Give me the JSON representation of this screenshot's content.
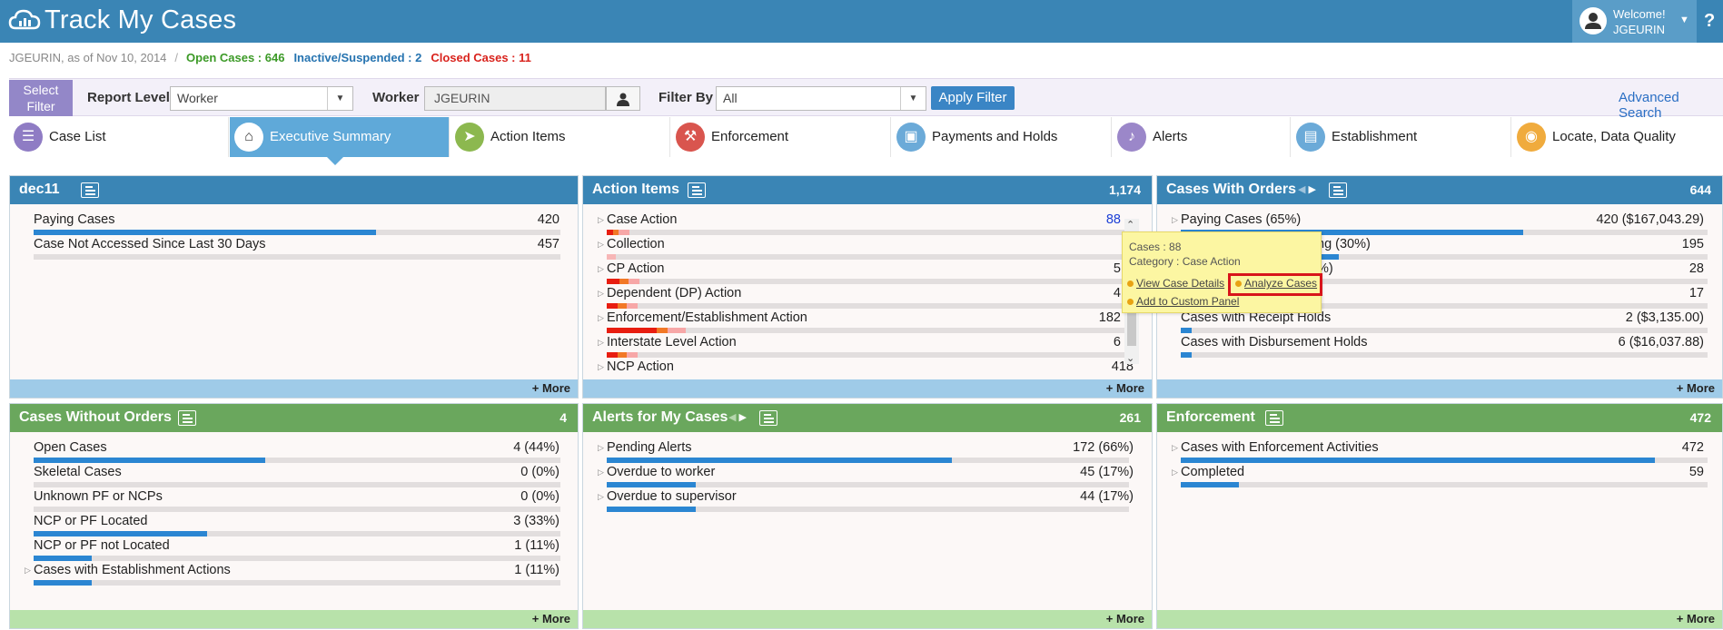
{
  "app": {
    "title": "Track My Cases"
  },
  "user": {
    "welcome": "Welcome!",
    "name": "JGEURIN"
  },
  "status": {
    "user_line": "JGEURIN, as of Nov 10, 2014",
    "separator": "/",
    "open_cases": "Open Cases : 646",
    "inactive": "Inactive/Suspended : 2",
    "closed": "Closed Cases : 11"
  },
  "filter": {
    "select_filter": "Select Filter",
    "report_level_label": "Report Level",
    "report_level_value": "Worker",
    "worker_label": "Worker",
    "worker_value": "JGEURIN",
    "filter_by_label": "Filter By",
    "filter_by_value": "All",
    "apply": "Apply Filter",
    "advanced": "Advanced Search"
  },
  "tabs": [
    {
      "label": "Case List",
      "icon": "list-icon",
      "color": "#8f7cc4"
    },
    {
      "label": "Executive Summary",
      "icon": "home-icon",
      "color": "#ffffff",
      "active": true
    },
    {
      "label": "Action Items",
      "icon": "send-icon",
      "color": "#8cb84f"
    },
    {
      "label": "Enforcement",
      "icon": "gavel-icon",
      "color": "#d9554e"
    },
    {
      "label": "Payments and Holds",
      "icon": "money-icon",
      "color": "#6baad8"
    },
    {
      "label": "Alerts",
      "icon": "bell-icon",
      "color": "#9b87c9"
    },
    {
      "label": "Establishment",
      "icon": "briefcase-icon",
      "color": "#6baad8"
    },
    {
      "label": "Locate, Data Quality",
      "icon": "map-pin-icon",
      "color": "#f0ab3d"
    }
  ],
  "panels": {
    "dec11": {
      "title": "dec11",
      "count": "",
      "more": "+ More",
      "rows": [
        {
          "label": "Paying Cases",
          "value": "420",
          "pct": 0.65
        },
        {
          "label": "Case Not Accessed Since Last 30 Days",
          "value": "457",
          "pct": 0
        }
      ]
    },
    "action_items": {
      "title": "Action Items",
      "count": "1,174",
      "more": "+ More",
      "rows": [
        {
          "label": "Case Action",
          "value": "88"
        },
        {
          "label": "Collection",
          "value": ""
        },
        {
          "label": "CP Action",
          "value": "5"
        },
        {
          "label": "Dependent (DP) Action",
          "value": "4"
        },
        {
          "label": "Enforcement/Establishment Action",
          "value": "182"
        },
        {
          "label": "Interstate Level Action",
          "value": "6"
        },
        {
          "label": "NCP Action",
          "value": "418"
        }
      ]
    },
    "cases_with_orders": {
      "title": "Cases With Orders",
      "count": "644",
      "more": "+ More",
      "rows": [
        {
          "label": "Paying Cases (65%)",
          "value": "420 ($167,043.29)",
          "pct": 0.65
        },
        {
          "label": "ng (30%)",
          "value": "195",
          "pct": 0.3
        },
        {
          "label": "%)",
          "value": "28",
          "pct": 0.04
        },
        {
          "label": ")",
          "value": "17",
          "pct": 0.03
        },
        {
          "label": "Cases with Receipt Holds",
          "value": "2 ($3,135.00)",
          "pct": 0.02
        },
        {
          "label": "Cases with Disbursement Holds",
          "value": "6 ($16,037.88)",
          "pct": 0.02
        }
      ]
    },
    "cases_without_orders": {
      "title": "Cases Without Orders",
      "count": "4",
      "more": "+ More",
      "rows": [
        {
          "label": "Open Cases",
          "value": "4 (44%)",
          "pct": 0.44
        },
        {
          "label": "Skeletal Cases",
          "value": "0 (0%)",
          "pct": 0
        },
        {
          "label": "Unknown PF or NCPs",
          "value": "0 (0%)",
          "pct": 0
        },
        {
          "label": "NCP or PF Located",
          "value": "3 (33%)",
          "pct": 0.33
        },
        {
          "label": "NCP or PF not Located",
          "value": "1 (11%)",
          "pct": 0.11
        },
        {
          "label": "Cases with Establishment Actions",
          "value": "1 (11%)",
          "pct": 0.11
        }
      ]
    },
    "alerts": {
      "title": "Alerts for My Cases",
      "count": "261",
      "more": "+ More",
      "rows": [
        {
          "label": "Pending Alerts",
          "value": "172 (66%)",
          "pct": 0.66
        },
        {
          "label": "Overdue to worker",
          "value": "45 (17%)",
          "pct": 0.17
        },
        {
          "label": "Overdue to supervisor",
          "value": "44 (17%)",
          "pct": 0.17
        }
      ]
    },
    "enforcement": {
      "title": "Enforcement",
      "count": "472",
      "more": "+ More",
      "rows": [
        {
          "label": "Cases with Enforcement Activities",
          "value": "472",
          "pct": 0.9
        },
        {
          "label": "Completed",
          "value": "59",
          "pct": 0.11
        }
      ]
    }
  },
  "popup": {
    "cases": "Cases : 88",
    "category": "Category : Case Action",
    "view": "View Case Details",
    "analyze": "Analyze Cases",
    "add": "Add to Custom Panel"
  }
}
